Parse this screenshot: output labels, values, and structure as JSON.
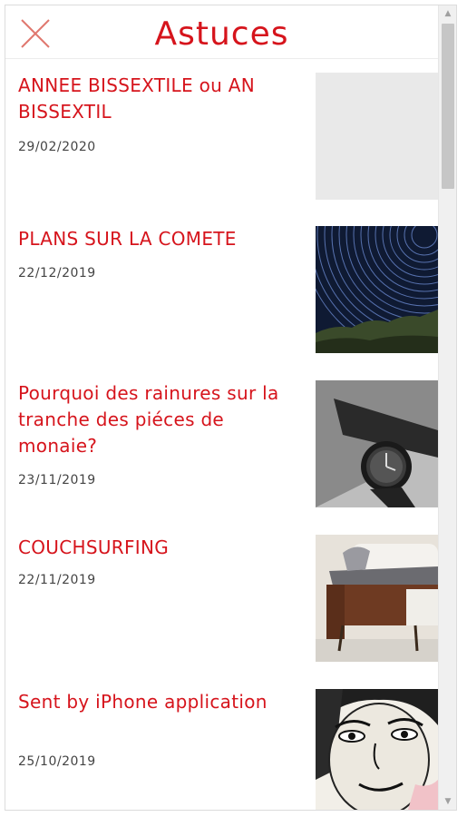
{
  "header": {
    "title": "Astuces",
    "close_icon": "close-icon"
  },
  "articles": [
    {
      "title": "ANNEE BISSEXTILE ou AN BISSEXTIL",
      "date": "29/02/2020",
      "image": "blank-placeholder"
    },
    {
      "title": "PLANS SUR LA COMETE",
      "date": "22/12/2019",
      "image": "star-trails-photo"
    },
    {
      "title": "Pourquoi des rainures sur la tranche des piéces de monaie?",
      "date": "23/11/2019",
      "image": "wristwatch-photo"
    },
    {
      "title": "COUCHSURFING",
      "date": "22/11/2019",
      "image": "person-on-couch-photo"
    },
    {
      "title": "Sent by iPhone application",
      "date": "25/10/2019",
      "image": "illustrated-face"
    }
  ],
  "colors": {
    "accent": "#d6141c",
    "date_text": "#444444"
  }
}
